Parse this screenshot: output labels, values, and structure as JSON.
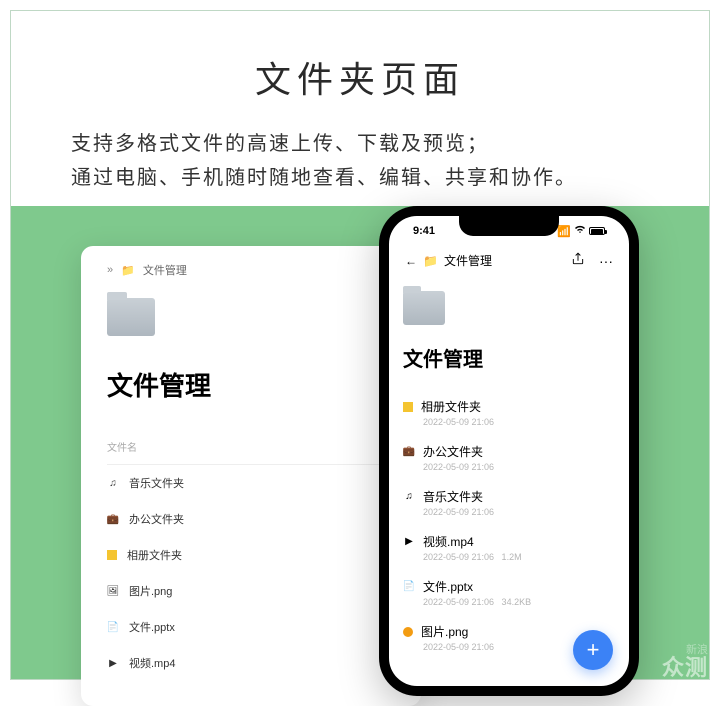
{
  "header": {
    "title": "文件夹页面",
    "desc_line1": "支持多格式文件的高速上传、下载及预览；",
    "desc_line2": "通过电脑、手机随时随地查看、编辑、共享和协作。"
  },
  "desktop": {
    "breadcrumb_chevrons": "»",
    "breadcrumb": "文件管理",
    "page_title": "文件管理",
    "column_header": "文件名",
    "items": [
      {
        "icon": "music-icon",
        "glyph": "♫",
        "name": "音乐文件夹"
      },
      {
        "icon": "briefcase-icon",
        "glyph": "💼",
        "name": "办公文件夹"
      },
      {
        "icon": "gallery-icon",
        "glyph": "▢",
        "name": "相册文件夹"
      },
      {
        "icon": "image-icon",
        "glyph": "🖼",
        "name": "图片.png"
      },
      {
        "icon": "document-icon",
        "glyph": "📄",
        "name": "文件.pptx"
      },
      {
        "icon": "video-icon",
        "glyph": "▶",
        "name": "视频.mp4"
      }
    ]
  },
  "phone": {
    "status_time": "9:41",
    "back": "←",
    "breadcrumb": "文件管理",
    "page_title": "文件管理",
    "items": [
      {
        "icon": "gallery-icon",
        "glyph": "▢",
        "name": "相册文件夹",
        "date": "2022-05-09 21:06",
        "size": ""
      },
      {
        "icon": "briefcase-icon",
        "glyph": "💼",
        "name": "办公文件夹",
        "date": "2022-05-09 21:06",
        "size": ""
      },
      {
        "icon": "music-icon",
        "glyph": "♫",
        "name": "音乐文件夹",
        "date": "2022-05-09 21:06",
        "size": ""
      },
      {
        "icon": "video-icon",
        "glyph": "▶",
        "name": "视频.mp4",
        "date": "2022-05-09 21:06",
        "size": "1.2M"
      },
      {
        "icon": "document-icon",
        "glyph": "📄",
        "name": "文件.pptx",
        "date": "2022-05-09 21:06",
        "size": "34.2KB"
      },
      {
        "icon": "image-circle-icon",
        "glyph": "●",
        "name": "图片.png",
        "date": "2022-05-09 21:06",
        "size": ""
      }
    ],
    "fab": "+"
  },
  "watermark": {
    "line1": "新浪",
    "line2": "众测"
  }
}
